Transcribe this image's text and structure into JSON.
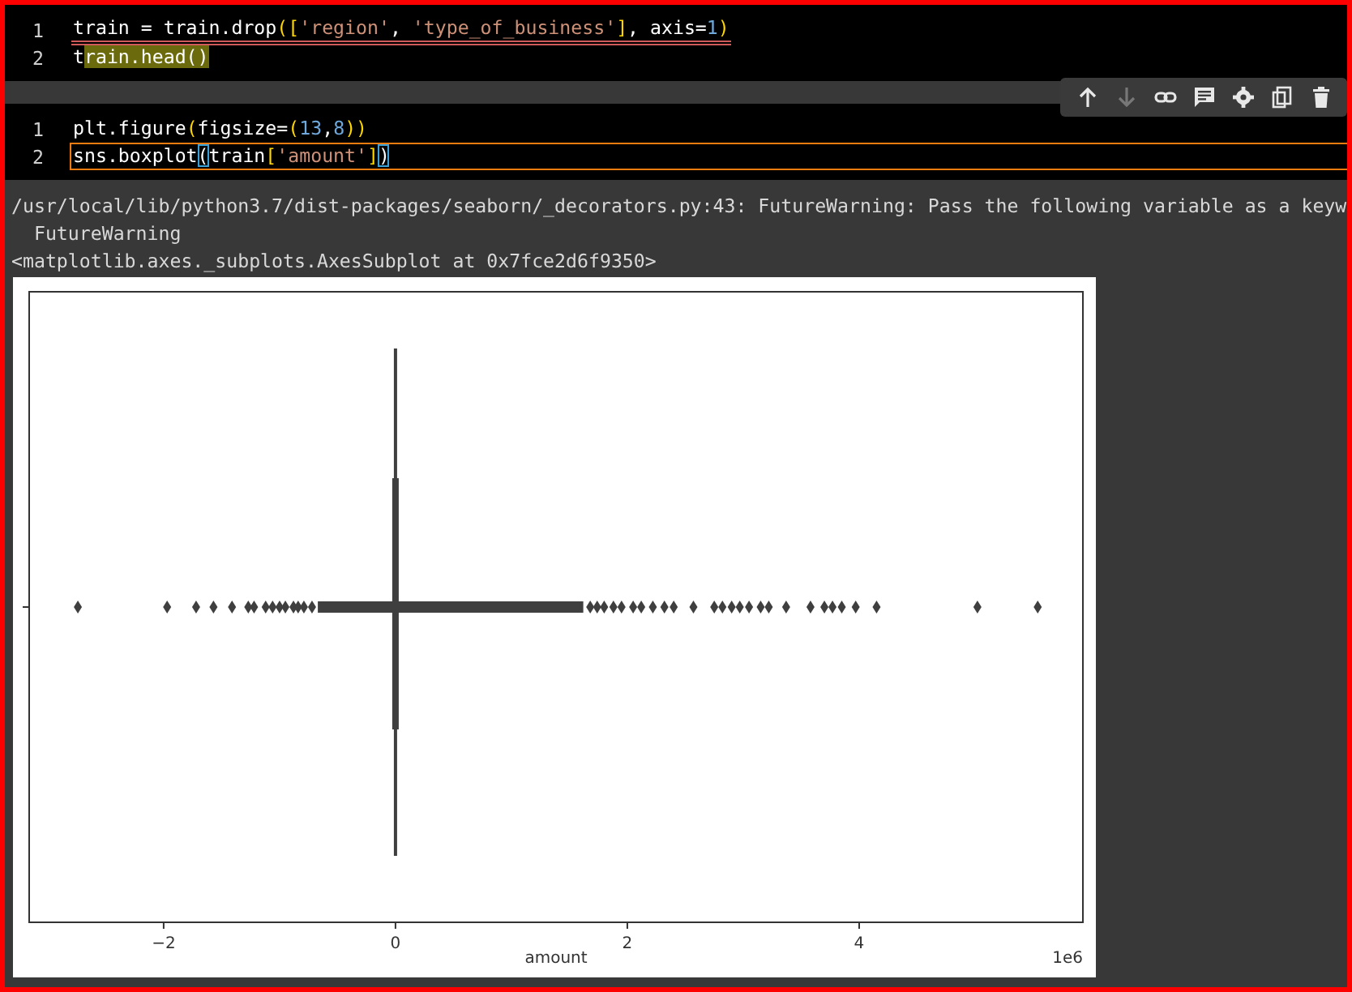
{
  "cells": [
    {
      "lines": [
        {
          "number": "1",
          "underlined": true,
          "current": false,
          "tokens": [
            {
              "text": "train = train.drop",
              "kind": "plain"
            },
            {
              "text": "(",
              "kind": "bracket"
            },
            {
              "text": "[",
              "kind": "bracket"
            },
            {
              "text": "'region'",
              "kind": "string"
            },
            {
              "text": ", ",
              "kind": "plain"
            },
            {
              "text": "'type_of_business'",
              "kind": "string"
            },
            {
              "text": "]",
              "kind": "bracket"
            },
            {
              "text": ", axis=",
              "kind": "plain"
            },
            {
              "text": "1",
              "kind": "number"
            },
            {
              "text": ")",
              "kind": "bracket"
            }
          ]
        },
        {
          "number": "2",
          "underlined": false,
          "current": false,
          "tokens": [
            {
              "text": "t",
              "kind": "plain"
            },
            {
              "text": "rain.head()",
              "kind": "match"
            }
          ]
        }
      ]
    },
    {
      "lines": [
        {
          "number": "1",
          "underlined": false,
          "current": false,
          "tokens": [
            {
              "text": "plt.figure",
              "kind": "plain"
            },
            {
              "text": "(",
              "kind": "bracket"
            },
            {
              "text": "figsize=",
              "kind": "plain"
            },
            {
              "text": "(",
              "kind": "bracket"
            },
            {
              "text": "13",
              "kind": "number"
            },
            {
              "text": ",",
              "kind": "plain"
            },
            {
              "text": "8",
              "kind": "number"
            },
            {
              "text": "))",
              "kind": "bracket"
            }
          ]
        },
        {
          "number": "2",
          "underlined": false,
          "current": true,
          "tokens": [
            {
              "text": "sns.boxplot",
              "kind": "plain"
            },
            {
              "text": "(",
              "kind": "bracket_match"
            },
            {
              "text": "train",
              "kind": "plain"
            },
            {
              "text": "[",
              "kind": "bracket"
            },
            {
              "text": "'amount'",
              "kind": "string"
            },
            {
              "text": "]",
              "kind": "bracket"
            },
            {
              "text": ")",
              "kind": "bracket_match"
            }
          ]
        }
      ]
    }
  ],
  "toolbar": [
    {
      "kind": "up",
      "disabled": false
    },
    {
      "kind": "down",
      "disabled": true
    },
    {
      "kind": "link",
      "disabled": false
    },
    {
      "kind": "comment",
      "disabled": false
    },
    {
      "kind": "settings",
      "disabled": false
    },
    {
      "kind": "mirror",
      "disabled": false
    },
    {
      "kind": "delete",
      "disabled": false
    }
  ],
  "output": {
    "lines": [
      "/usr/local/lib/python3.7/dist-packages/seaborn/_decorators.py:43: FutureWarning: Pass the following variable as a keyw",
      "  FutureWarning",
      "<matplotlib.axes._subplots.AxesSubplot at 0x7fce2d6f9350>"
    ],
    "plot": {
      "xlabel": "amount",
      "tick_labels": [
        "−2",
        "0",
        "2",
        "4"
      ],
      "offset_label": "1e6"
    }
  }
}
